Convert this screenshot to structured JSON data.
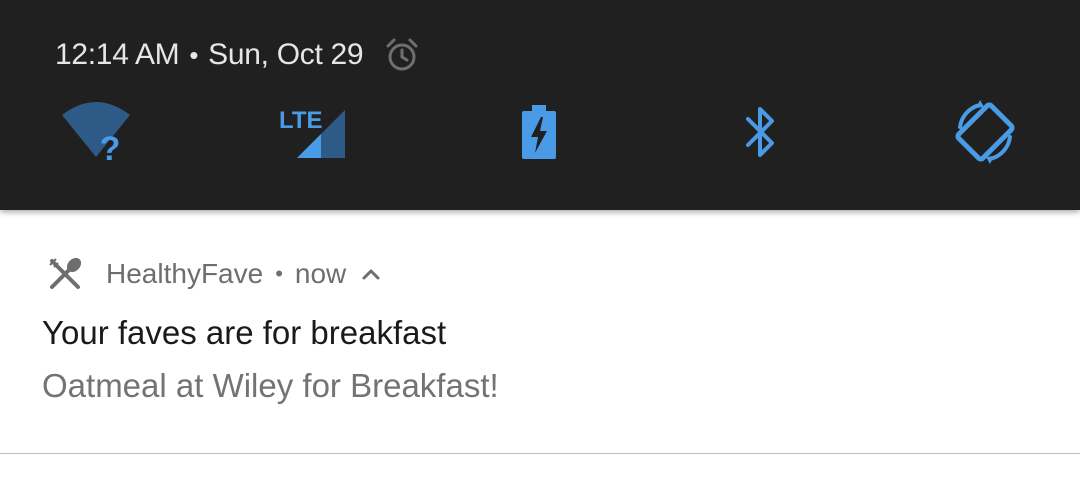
{
  "status_bar": {
    "time": "12:14 AM",
    "separator": "•",
    "date": "Sun, Oct 29",
    "alarm_icon": "alarm-clock-icon"
  },
  "quick_settings": {
    "accent_color": "#4a9be6",
    "tiles": [
      {
        "name": "wifi",
        "icon": "wifi-unknown-icon",
        "badge": "?"
      },
      {
        "name": "mobile-data",
        "icon": "lte-signal-icon",
        "label": "LTE"
      },
      {
        "name": "battery-saver",
        "icon": "battery-charging-icon"
      },
      {
        "name": "bluetooth",
        "icon": "bluetooth-icon"
      },
      {
        "name": "auto-rotate",
        "icon": "auto-rotate-icon"
      }
    ]
  },
  "notification": {
    "app_icon": "fork-spoon-icon",
    "app_name": "HealthyFave",
    "dot": "•",
    "time": "now",
    "expand_icon": "chevron-up-icon",
    "title": "Your faves are for breakfast",
    "body": "Oatmeal at Wiley for Breakfast!"
  }
}
